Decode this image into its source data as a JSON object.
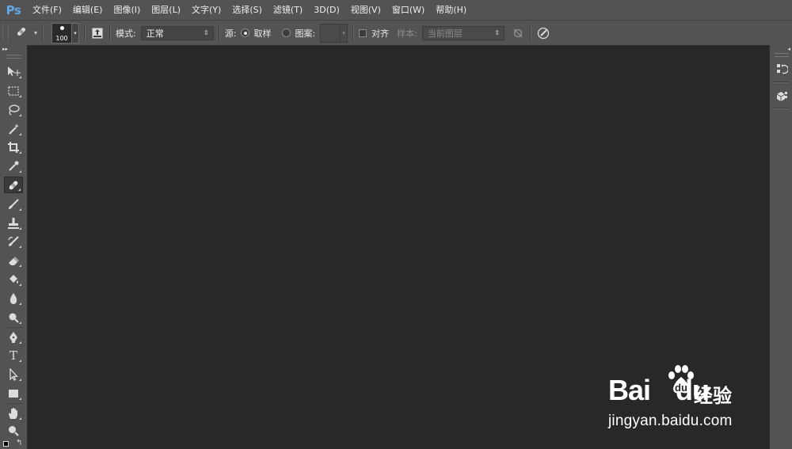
{
  "app": {
    "logo": "Ps"
  },
  "menu": [
    "文件(F)",
    "编辑(E)",
    "图像(I)",
    "图层(L)",
    "文字(Y)",
    "选择(S)",
    "滤镜(T)",
    "3D(D)",
    "视图(V)",
    "窗口(W)",
    "帮助(H)"
  ],
  "options": {
    "brush_size": "100",
    "mode_label": "模式:",
    "mode_value": "正常",
    "source_label": "源:",
    "sampled_label": "取样",
    "pattern_label": "图案:",
    "aligned_label": "对齐",
    "sample_label": "样本:",
    "sample_value": "当前图层",
    "source_selected": "取样",
    "aligned_checked": false
  },
  "tools": [
    {
      "name": "move-tool-icon"
    },
    {
      "name": "marquee-tool-icon"
    },
    {
      "name": "lasso-tool-icon"
    },
    {
      "name": "magic-wand-tool-icon"
    },
    {
      "name": "crop-tool-icon"
    },
    {
      "name": "eyedropper-tool-icon"
    },
    {
      "name": "healing-brush-tool-icon",
      "active": true
    },
    {
      "name": "brush-tool-icon"
    },
    {
      "name": "clone-stamp-tool-icon"
    },
    {
      "name": "history-brush-tool-icon"
    },
    {
      "name": "eraser-tool-icon"
    },
    {
      "name": "paint-bucket-tool-icon"
    },
    {
      "name": "blur-tool-icon"
    },
    {
      "name": "dodge-tool-icon"
    },
    {
      "name": "pen-tool-icon"
    },
    {
      "name": "type-tool-icon",
      "glyph": "T"
    },
    {
      "name": "path-selection-tool-icon"
    },
    {
      "name": "rectangle-tool-icon"
    },
    {
      "name": "hand-tool-icon"
    },
    {
      "name": "zoom-tool-icon"
    }
  ],
  "colors": {
    "menubar_bg": "#535353",
    "canvas_bg": "#282828",
    "logo_blue": "#5ea9e6"
  },
  "watermark": {
    "brand": "Bai",
    "brand_suffix": "du",
    "product": "经验",
    "url": "jingyan.baidu.com"
  }
}
